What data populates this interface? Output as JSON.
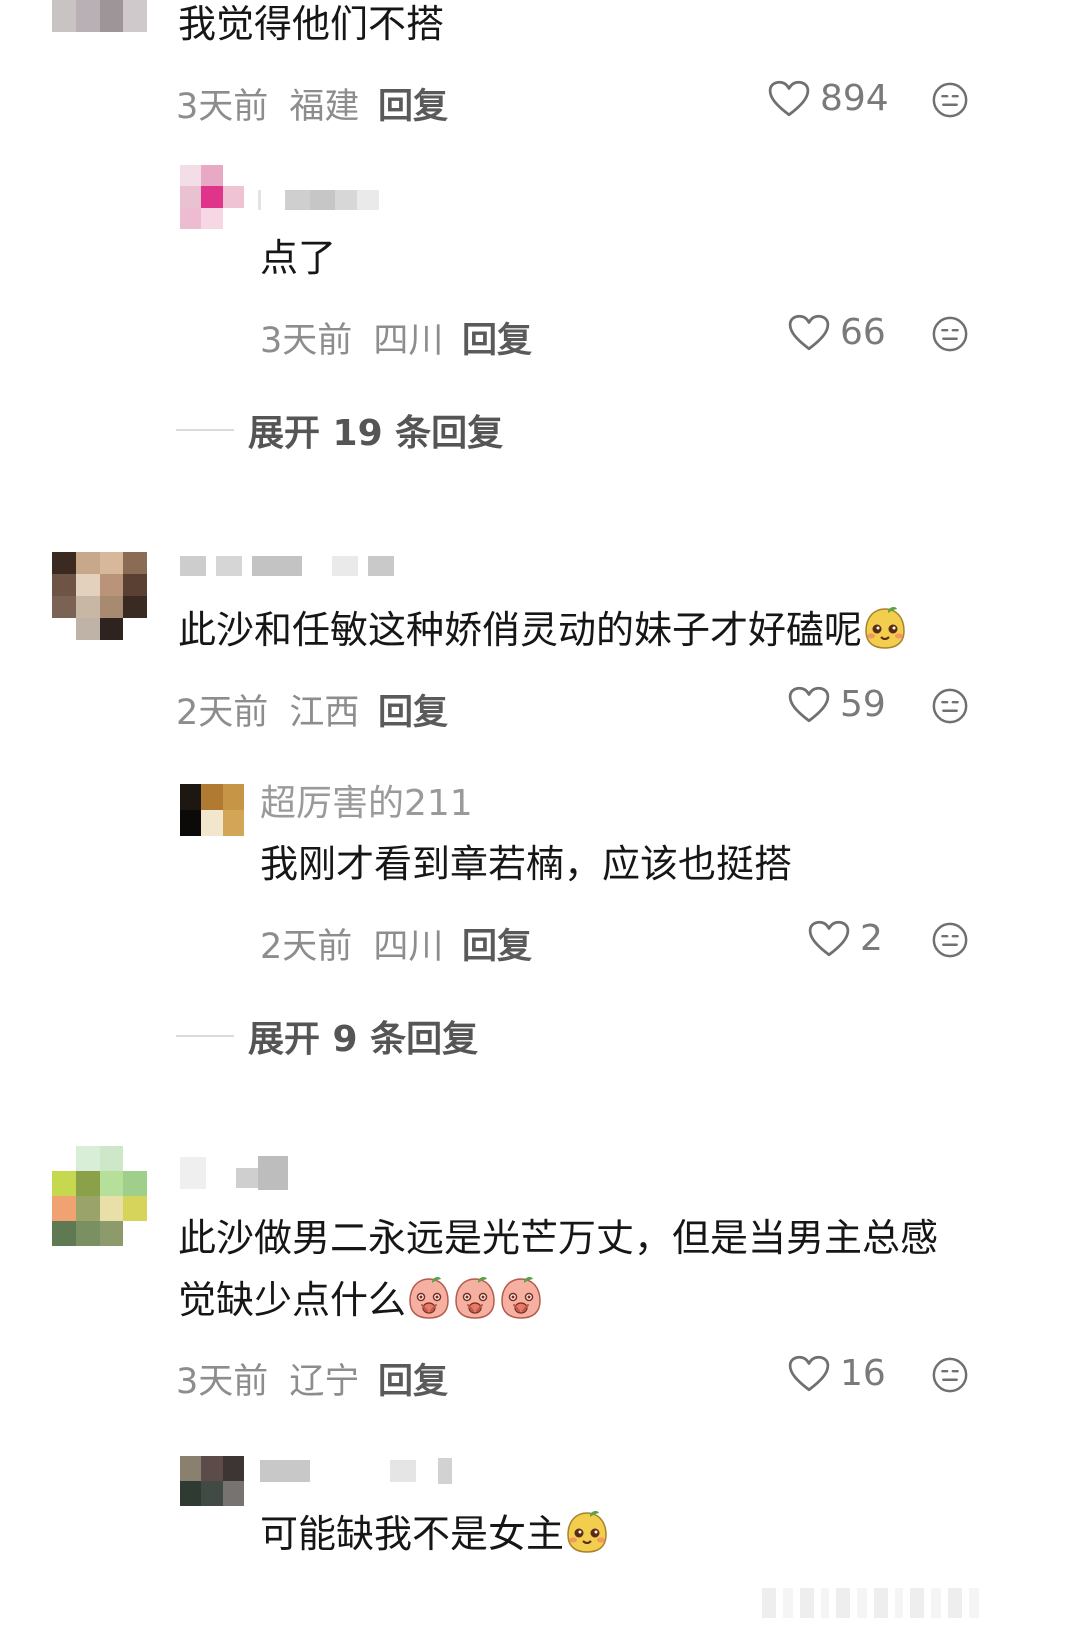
{
  "comments": [
    {
      "text": "我觉得他们不搭",
      "time": "3天前",
      "location": "福建",
      "reply_label": "回复",
      "likes": "894",
      "replies": [
        {
          "text": "点了",
          "time": "3天前",
          "location": "四川",
          "reply_label": "回复",
          "likes": "66"
        }
      ],
      "expand_label": "展开 19 条回复"
    },
    {
      "text": "此沙和任敏这种娇俏灵动的妹子才好磕呢",
      "time": "2天前",
      "location": "江西",
      "reply_label": "回复",
      "likes": "59",
      "replies": [
        {
          "username": "超厉害的211",
          "text": "我刚才看到章若楠，应该也挺搭",
          "time": "2天前",
          "location": "四川",
          "reply_label": "回复",
          "likes": "2"
        }
      ],
      "expand_label": "展开 9 条回复"
    },
    {
      "text_line1": "此沙做男二永远是光芒万丈，但是当男主总感",
      "text_line2": "觉缺少点什么",
      "time": "3天前",
      "location": "辽宁",
      "reply_label": "回复",
      "likes": "16",
      "replies": [
        {
          "text": "可能缺我不是女主"
        }
      ]
    }
  ],
  "icons": {
    "like": "heart-outline-icon",
    "dislike": "neutral-face-icon",
    "emoji_yellow": "yellow-sticker-emoji",
    "emoji_pink": "pink-sticker-emoji"
  },
  "colors": {
    "text": "#161616",
    "meta": "#8d8d8d",
    "reply": "#5a5a5a"
  }
}
